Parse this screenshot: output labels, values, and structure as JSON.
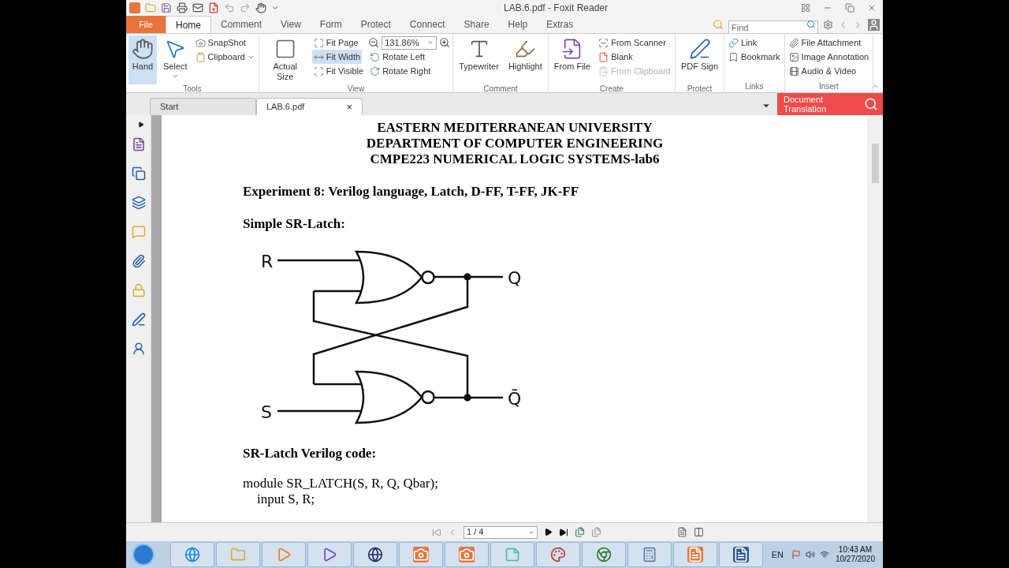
{
  "window": {
    "title": "LAB.6.pdf - Foxit Reader"
  },
  "menu_tabs": [
    {
      "label": "File",
      "kind": "file",
      "selected": false
    },
    {
      "label": "Home",
      "kind": "tab",
      "selected": true
    },
    {
      "label": "Comment",
      "kind": "tab",
      "selected": false
    },
    {
      "label": "View",
      "kind": "tab",
      "selected": false
    },
    {
      "label": "Form",
      "kind": "tab",
      "selected": false
    },
    {
      "label": "Protect",
      "kind": "tab",
      "selected": false
    },
    {
      "label": "Connect",
      "kind": "tab",
      "selected": false
    },
    {
      "label": "Share",
      "kind": "tab",
      "selected": false
    },
    {
      "label": "Help",
      "kind": "tab",
      "selected": false
    },
    {
      "label": "Extras",
      "kind": "tab",
      "selected": false
    }
  ],
  "find": {
    "placeholder": "Find"
  },
  "ribbon_groups": [
    {
      "label": "Tools",
      "columns": [
        [
          {
            "label": "Hand",
            "kind": "large",
            "selected": true,
            "disabled": false
          }
        ],
        [
          {
            "label": "Select",
            "kind": "large_dropdown",
            "selected": false,
            "disabled": false
          }
        ],
        [
          {
            "label": "SnapShot",
            "kind": "small",
            "selected": false,
            "disabled": false
          },
          {
            "label": "Clipboard",
            "kind": "small_dropdown",
            "selected": false,
            "disabled": false
          }
        ]
      ]
    },
    {
      "label": "View",
      "columns": [
        [
          {
            "label": "Actual Size",
            "kind": "large",
            "selected": false,
            "disabled": false
          }
        ],
        [
          {
            "label": "Fit Page",
            "kind": "small",
            "selected": false,
            "disabled": false
          },
          {
            "label": "Fit Width",
            "kind": "small",
            "selected": true,
            "disabled": false
          },
          {
            "label": "Fit Visible",
            "kind": "small",
            "selected": false,
            "disabled": false
          }
        ],
        [
          {
            "label": "131.86%",
            "kind": "zoom"
          },
          {
            "label": "Rotate Left",
            "kind": "small",
            "selected": false,
            "disabled": false
          },
          {
            "label": "Rotate Right",
            "kind": "small",
            "selected": false,
            "disabled": false
          }
        ]
      ]
    },
    {
      "label": "Comment",
      "columns": [
        [
          {
            "label": "Typewriter",
            "kind": "large",
            "selected": false,
            "disabled": false
          }
        ],
        [
          {
            "label": "Highlight",
            "kind": "large",
            "selected": false,
            "disabled": false
          }
        ]
      ]
    },
    {
      "label": "Create",
      "columns": [
        [
          {
            "label": "From File",
            "kind": "large",
            "selected": false,
            "disabled": false
          }
        ],
        [
          {
            "label": "From Scanner",
            "kind": "small",
            "selected": false,
            "disabled": false
          },
          {
            "label": "Blank",
            "kind": "small",
            "selected": false,
            "disabled": false
          },
          {
            "label": "From Clipboard",
            "kind": "small",
            "selected": false,
            "disabled": true
          }
        ]
      ]
    },
    {
      "label": "Protect",
      "columns": [
        [
          {
            "label": "PDF Sign",
            "kind": "large",
            "selected": false,
            "disabled": false
          }
        ]
      ]
    },
    {
      "label": "Links",
      "columns": [
        [
          {
            "label": "Link",
            "kind": "small",
            "selected": false,
            "disabled": false
          },
          {
            "label": "Bookmark",
            "kind": "small",
            "selected": false,
            "disabled": false
          }
        ]
      ]
    },
    {
      "label": "Insert",
      "columns": [
        [
          {
            "label": "File Attachment",
            "kind": "small",
            "selected": false,
            "disabled": false
          },
          {
            "label": "Image Annotation",
            "kind": "small",
            "selected": false,
            "disabled": false
          },
          {
            "label": "Audio & Video",
            "kind": "small",
            "selected": false,
            "disabled": false
          }
        ]
      ]
    }
  ],
  "doc_tabs": [
    {
      "label": "Start",
      "selected": false
    },
    {
      "label": "LAB.6.pdf",
      "selected": true,
      "close": "×"
    }
  ],
  "translation_button": {
    "lines": [
      "Document",
      "Translation"
    ]
  },
  "document": {
    "title_lines": [
      "EASTERN MEDITERRANEAN UNIVERSITY",
      "DEPARTMENT OF COMPUTER ENGINEERING",
      "CMPE223 NUMERICAL LOGIC SYSTEMS-lab6"
    ],
    "blocks": [
      {
        "kind": "heading",
        "text": "Experiment 8: Verilog language, Latch, D-FF, T-FF, JK-FF"
      },
      {
        "kind": "heading",
        "text": "Simple SR-Latch:"
      },
      {
        "kind": "circuit",
        "r": "R",
        "s": "S",
        "q": "Q",
        "q_bar": "Q̄"
      },
      {
        "kind": "heading",
        "text": "SR-Latch Verilog code:"
      },
      {
        "kind": "code",
        "text": "module SR_LATCH(S, R, Q, Qbar);"
      },
      {
        "kind": "code_indented",
        "text": "input S, R;"
      }
    ]
  },
  "status_bar": {
    "page_field": "1 / 4"
  },
  "taskbar": {
    "language": "EN",
    "time": "10:43 AM",
    "date": "10/27/2020"
  }
}
